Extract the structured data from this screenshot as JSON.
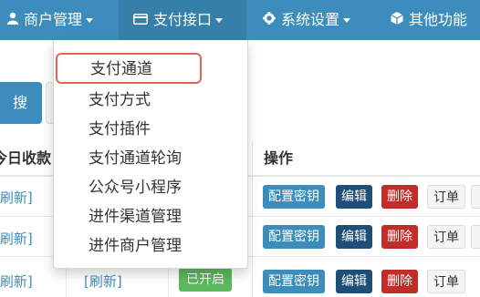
{
  "navbar": {
    "items": [
      {
        "label": "商户管理",
        "icon": "user-icon"
      },
      {
        "label": "支付接口",
        "icon": "card-icon"
      },
      {
        "label": "系统设置",
        "icon": "gear-icon"
      },
      {
        "label": "其他功能",
        "icon": "cube-icon"
      }
    ]
  },
  "toolbar": {
    "search_label": "搜索"
  },
  "table": {
    "headers": {
      "today_income": "今日收款",
      "actions": "操作"
    },
    "refresh_link": "[刷新]",
    "status_on": "已开启",
    "actions": {
      "key": "配置密钥",
      "edit": "编辑",
      "delete": "删除",
      "order": "订单"
    }
  },
  "dropdown": {
    "items": [
      "支付通道",
      "支付方式",
      "支付插件",
      "支付通道轮询",
      "公众号小程序",
      "进件渠道管理",
      "进件商户管理"
    ]
  },
  "colors": {
    "primary": "#3c8dbc",
    "danger": "#c12e2a",
    "success": "#5cb85c",
    "highlight": "#e2655a"
  }
}
